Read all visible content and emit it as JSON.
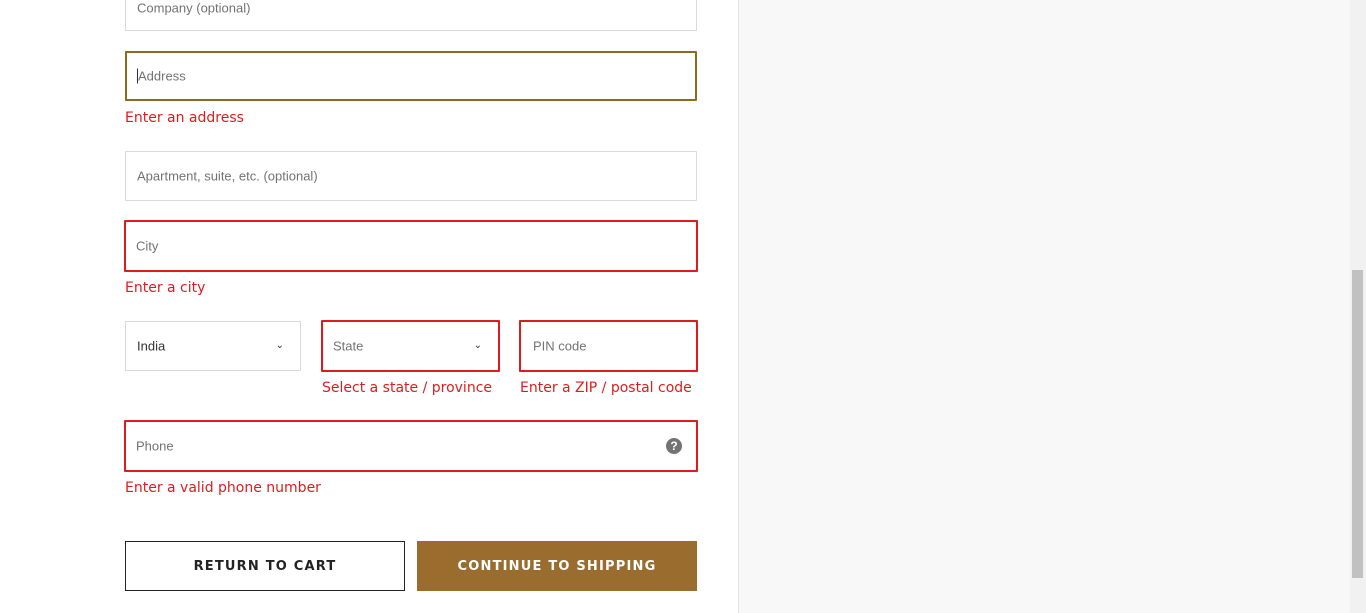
{
  "form": {
    "company": {
      "placeholder": "Company (optional)"
    },
    "address": {
      "placeholder": "Address",
      "error": "Enter an address"
    },
    "apartment": {
      "placeholder": "Apartment, suite, etc. (optional)"
    },
    "city": {
      "placeholder": "City",
      "error": "Enter a city"
    },
    "country": {
      "value": "India"
    },
    "state": {
      "placeholder": "State",
      "error": "Select a state / province"
    },
    "pin": {
      "placeholder": "PIN code",
      "error": "Enter a ZIP / postal code"
    },
    "phone": {
      "placeholder": "Phone",
      "error": "Enter a valid phone number",
      "help_icon": "?"
    }
  },
  "buttons": {
    "return": "RETURN TO CART",
    "continue": "CONTINUE TO SHIPPING"
  },
  "colors": {
    "error": "#dd1d1d",
    "accent": "#9a6d2e"
  }
}
